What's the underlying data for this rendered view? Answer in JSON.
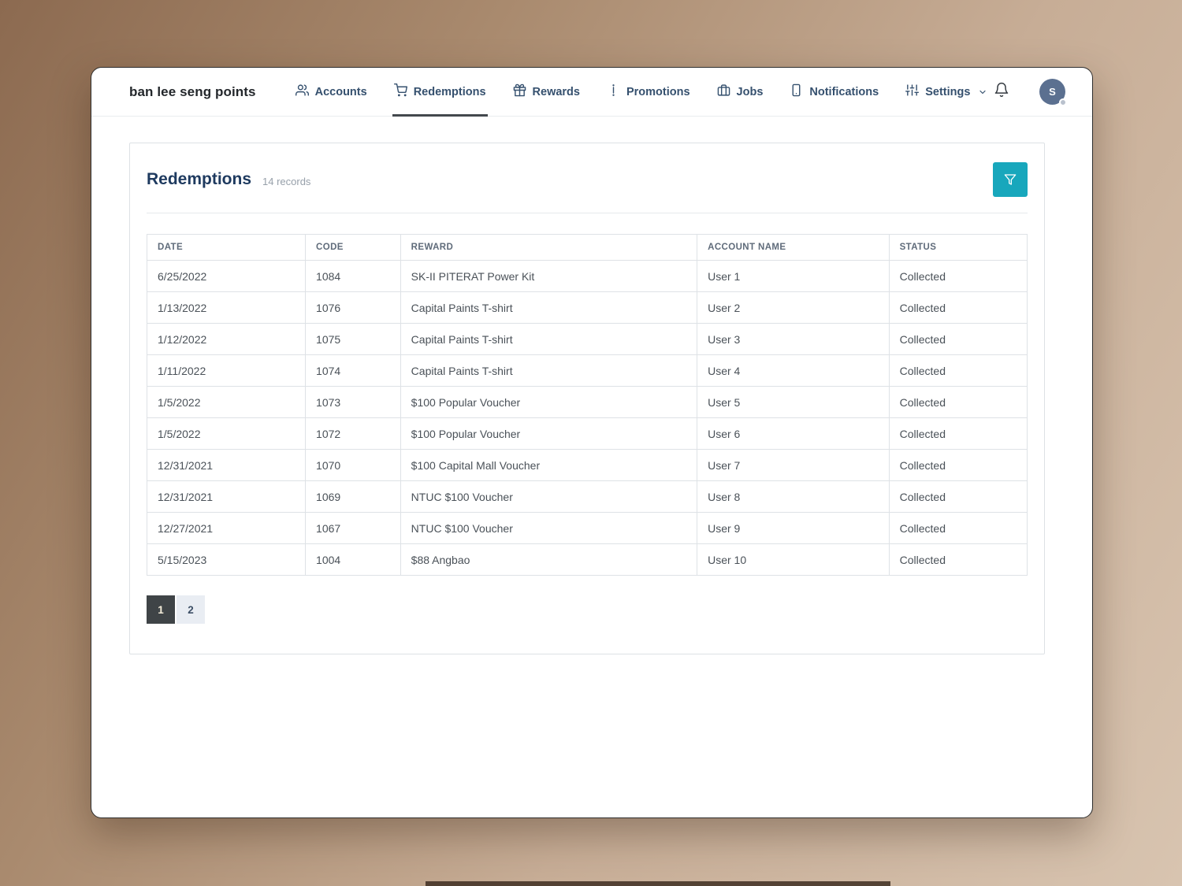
{
  "brand": "ban lee seng points",
  "nav": {
    "items": [
      {
        "label": "Accounts",
        "icon": "users-icon",
        "active": false
      },
      {
        "label": "Redemptions",
        "icon": "cart-icon",
        "active": true
      },
      {
        "label": "Rewards",
        "icon": "gift-icon",
        "active": false
      },
      {
        "label": "Promotions",
        "icon": "promo-icon",
        "active": false
      },
      {
        "label": "Jobs",
        "icon": "briefcase-icon",
        "active": false
      },
      {
        "label": "Notifications",
        "icon": "smartphone-icon",
        "active": false
      },
      {
        "label": "Settings",
        "icon": "sliders-icon",
        "active": false,
        "has_dropdown": true
      }
    ]
  },
  "avatar": {
    "initial": "S"
  },
  "page": {
    "title": "Redemptions",
    "records_label": "14 records"
  },
  "table": {
    "columns": [
      "DATE",
      "CODE",
      "REWARD",
      "ACCOUNT NAME",
      "STATUS"
    ],
    "rows": [
      [
        "6/25/2022",
        "1084",
        "SK-II PITERAT Power Kit",
        "User 1",
        "Collected"
      ],
      [
        "1/13/2022",
        "1076",
        "Capital Paints T-shirt",
        "User 2",
        "Collected"
      ],
      [
        "1/12/2022",
        "1075",
        "Capital Paints T-shirt",
        "User 3",
        "Collected"
      ],
      [
        "1/11/2022",
        "1074",
        "Capital Paints T-shirt",
        "User 4",
        "Collected"
      ],
      [
        "1/5/2022",
        "1073",
        "$100 Popular Voucher",
        "User 5",
        "Collected"
      ],
      [
        "1/5/2022",
        "1072",
        "$100 Popular Voucher",
        "User 6",
        "Collected"
      ],
      [
        "12/31/2021",
        "1070",
        "$100 Capital Mall Voucher",
        "User 7",
        "Collected"
      ],
      [
        "12/31/2021",
        "1069",
        "NTUC $100 Voucher",
        "User 8",
        "Collected"
      ],
      [
        "12/27/2021",
        "1067",
        "NTUC $100 Voucher",
        "User 9",
        "Collected"
      ],
      [
        "5/15/2023",
        "1004",
        "$88 Angbao",
        "User 10",
        "Collected"
      ]
    ]
  },
  "pagination": {
    "pages": [
      "1",
      "2"
    ],
    "active": "1"
  },
  "colors": {
    "accent_teal": "#18a7bc",
    "nav_text": "#35506e",
    "title_navy": "#1e3a5f",
    "pagination_active_bg": "#3f4447",
    "background_brown_dark": "#8c6a50",
    "background_brown_light": "#d8c4b0"
  }
}
